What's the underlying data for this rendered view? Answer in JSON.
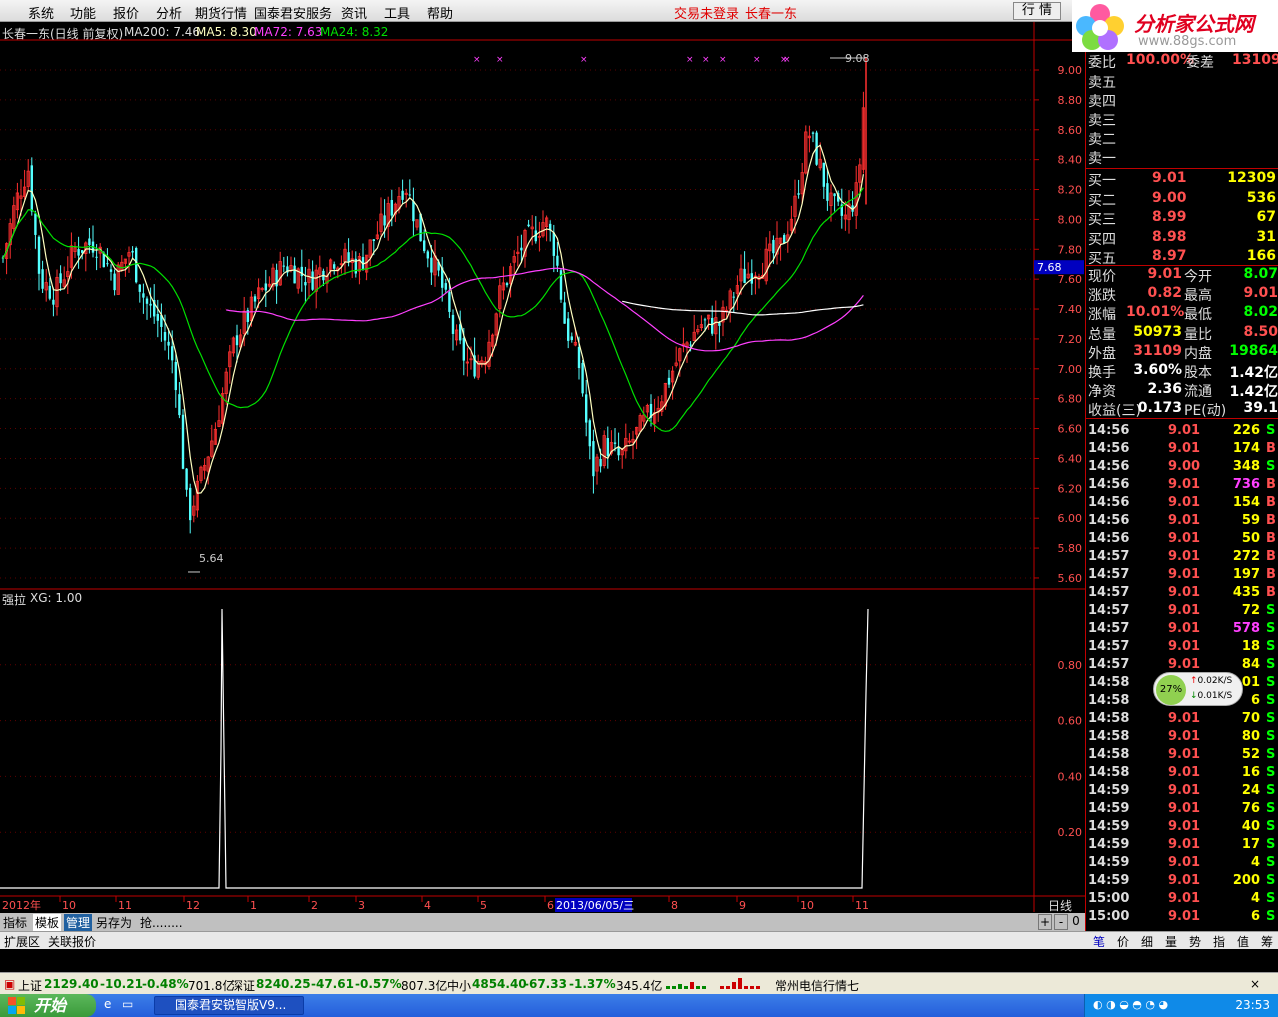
{
  "menu": {
    "items": [
      "系统",
      "功能",
      "报价",
      "分析",
      "期货行情",
      "国泰君安服务",
      "资讯",
      "工具",
      "帮助"
    ],
    "status_login": "交易未登录",
    "status_stock": "长春一东",
    "quote_button": "行 情"
  },
  "logo": {
    "text": "分析家公式网",
    "url": "www.88gs.com"
  },
  "chart_header": {
    "name": "长春一东(日线 前复权)",
    "ma200": "MA200: 7.46",
    "ma5": "MA5: 8.30",
    "ma72": "MA72: 7.63",
    "ma24": "MA24: 8.32"
  },
  "indicator_header": {
    "name": "强拉",
    "value": "XG: 1.00"
  },
  "colors": {
    "up": "#ff3030",
    "down": "#54ffff",
    "ma5": "#ffffc0",
    "ma24": "#00e000",
    "ma72": "#ff40ff",
    "ma200": "#ffffff",
    "axis": "#c00000",
    "price_red": "#ff5050",
    "price_green": "#00ff00",
    "yellow": "#ffff00"
  },
  "chart_data": [
    {
      "type": "candlestick",
      "title": "长春一东(日线 前复权)",
      "y_ticks": [
        9.0,
        8.8,
        8.6,
        8.4,
        8.2,
        8.0,
        7.8,
        7.6,
        7.4,
        7.2,
        7.0,
        6.8,
        6.6,
        6.4,
        6.2,
        6.0,
        5.8,
        5.6
      ],
      "ylim": [
        5.55,
        9.15
      ],
      "annotations": [
        {
          "label": "9.08"
        },
        {
          "label": "5.64"
        }
      ],
      "current_price_tag": "7.68",
      "x_labels": [
        "2012年",
        "10",
        "11",
        "12",
        "1",
        "2",
        "3",
        "4",
        "5",
        "6",
        "2013/06/05/三",
        "8",
        "9",
        "10",
        "11"
      ],
      "series": [
        {
          "name": "MA5",
          "value": "8.30"
        },
        {
          "name": "MA24",
          "value": "8.32"
        },
        {
          "name": "MA72",
          "value": "7.63"
        },
        {
          "name": "MA200",
          "value": "7.46"
        }
      ]
    },
    {
      "type": "line",
      "title": "强拉",
      "y_ticks": [
        0.8,
        0.6,
        0.4,
        0.2
      ],
      "ylim": [
        0,
        1.0
      ],
      "signals": [
        {
          "label": "2012-12",
          "value": 1.0
        },
        {
          "label": "11",
          "value": 1.0
        }
      ]
    }
  ],
  "bottom_tabs": [
    "指标",
    "模板",
    "管理",
    "另存为",
    "抢........"
  ],
  "ext_tabs": [
    "扩展区",
    "关联报价"
  ],
  "period_label": "日线",
  "right_panel": {
    "weibi": {
      "label": "委比",
      "value": "100.00%",
      "label2": "委差",
      "value2": "13109"
    },
    "sells": [
      "卖五",
      "卖四",
      "卖三",
      "卖二",
      "卖一"
    ],
    "buys": [
      {
        "label": "买一",
        "price": "9.01",
        "vol": "12309"
      },
      {
        "label": "买二",
        "price": "9.00",
        "vol": "536"
      },
      {
        "label": "买三",
        "price": "8.99",
        "vol": "67"
      },
      {
        "label": "买四",
        "price": "8.98",
        "vol": "31"
      },
      {
        "label": "买五",
        "price": "8.97",
        "vol": "166"
      }
    ],
    "stats": [
      {
        "l1": "现价",
        "v1": "9.01",
        "l2": "今开",
        "v2": "8.07"
      },
      {
        "l1": "涨跌",
        "v1": "0.82",
        "l2": "最高",
        "v2": "9.01"
      },
      {
        "l1": "涨幅",
        "v1": "10.01%",
        "l2": "最低",
        "v2": "8.02"
      },
      {
        "l1": "总量",
        "v1": "50973",
        "l2": "量比",
        "v2": "8.50"
      },
      {
        "l1": "外盘",
        "v1": "31109",
        "l2": "内盘",
        "v2": "19864"
      },
      {
        "l1": "换手",
        "v1": "3.60%",
        "l2": "股本",
        "v2": "1.42亿"
      },
      {
        "l1": "净资",
        "v1": "2.36",
        "l2": "流通",
        "v2": "1.42亿"
      },
      {
        "l1": "收益(三)",
        "v1": "0.173",
        "l2": "PE(动)",
        "v2": "39.1"
      }
    ],
    "ticks": [
      {
        "t": "14:56",
        "p": "9.01",
        "v": "226",
        "s": "S"
      },
      {
        "t": "14:56",
        "p": "9.01",
        "v": "174",
        "s": "B"
      },
      {
        "t": "14:56",
        "p": "9.00",
        "v": "348",
        "s": "S"
      },
      {
        "t": "14:56",
        "p": "9.01",
        "v": "736",
        "s": "B"
      },
      {
        "t": "14:56",
        "p": "9.01",
        "v": "154",
        "s": "B"
      },
      {
        "t": "14:56",
        "p": "9.01",
        "v": "59",
        "s": "B"
      },
      {
        "t": "14:56",
        "p": "9.01",
        "v": "50",
        "s": "B"
      },
      {
        "t": "14:57",
        "p": "9.01",
        "v": "272",
        "s": "B"
      },
      {
        "t": "14:57",
        "p": "9.01",
        "v": "197",
        "s": "B"
      },
      {
        "t": "14:57",
        "p": "9.01",
        "v": "435",
        "s": "B"
      },
      {
        "t": "14:57",
        "p": "9.01",
        "v": "72",
        "s": "S"
      },
      {
        "t": "14:57",
        "p": "9.01",
        "v": "578",
        "s": "S"
      },
      {
        "t": "14:57",
        "p": "9.01",
        "v": "18",
        "s": "S"
      },
      {
        "t": "14:57",
        "p": "9.01",
        "v": "84",
        "s": "S"
      },
      {
        "t": "14:58",
        "p": "9.01",
        "v": "01",
        "s": "S"
      },
      {
        "t": "14:58",
        "p": "9.01",
        "v": "6",
        "s": "S"
      },
      {
        "t": "14:58",
        "p": "9.01",
        "v": "70",
        "s": "S"
      },
      {
        "t": "14:58",
        "p": "9.01",
        "v": "80",
        "s": "S"
      },
      {
        "t": "14:58",
        "p": "9.01",
        "v": "52",
        "s": "S"
      },
      {
        "t": "14:58",
        "p": "9.01",
        "v": "16",
        "s": "S"
      },
      {
        "t": "14:59",
        "p": "9.01",
        "v": "24",
        "s": "S"
      },
      {
        "t": "14:59",
        "p": "9.01",
        "v": "76",
        "s": "S"
      },
      {
        "t": "14:59",
        "p": "9.01",
        "v": "40",
        "s": "S"
      },
      {
        "t": "14:59",
        "p": "9.01",
        "v": "17",
        "s": "S"
      },
      {
        "t": "14:59",
        "p": "9.01",
        "v": "4",
        "s": "S"
      },
      {
        "t": "14:59",
        "p": "9.01",
        "v": "200",
        "s": "S"
      },
      {
        "t": "15:00",
        "p": "9.01",
        "v": "4",
        "s": "S"
      },
      {
        "t": "15:00",
        "p": "9.01",
        "v": "6",
        "s": "S"
      }
    ],
    "tabs": [
      "笔",
      "价",
      "细",
      "量",
      "势",
      "指",
      "值",
      "筹"
    ]
  },
  "net_widget": {
    "percent": "27%",
    "up": "0.02K/S",
    "down": "0.01K/S"
  },
  "statusbar": {
    "sh": {
      "name": "上证",
      "val": "2129.40",
      "chg": "-10.21",
      "pct": "-0.48%",
      "amt": "701.8亿"
    },
    "sz": {
      "name": "深证",
      "val": "8240.25",
      "chg": "-47.61",
      "pct": "-0.57%",
      "amt": "807.3亿"
    },
    "zx": {
      "name": "中小",
      "val": "4854.40",
      "chg": "-67.33",
      "pct": "-1.37%",
      "amt": "345.4亿"
    },
    "server": "常州电信行情七"
  },
  "taskbar": {
    "start": "开始",
    "item": "国泰君安锐智版V9...",
    "clock": "23:53"
  }
}
